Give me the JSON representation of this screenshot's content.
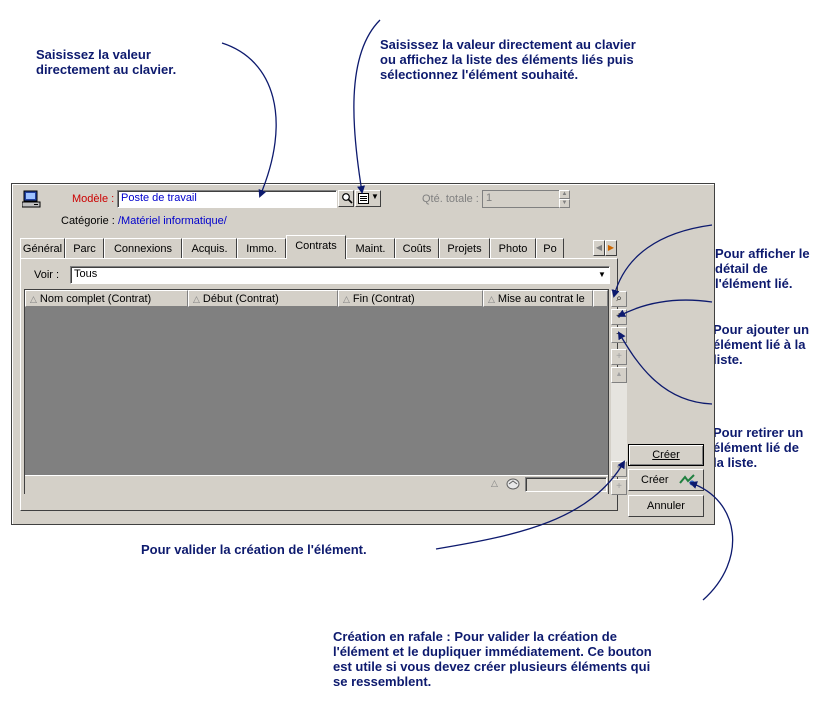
{
  "annotations": {
    "keyboard_input": [
      "Saisissez la valeur",
      "directement au clavier."
    ],
    "keyboard_or_list": [
      "Saisissez la valeur directement au clavier",
      "ou affichez la liste des éléments liés puis",
      "sélectionnez l'élément souhaité."
    ],
    "show_detail": [
      "Pour afficher le",
      "détail de",
      "l'élément lié."
    ],
    "add_linked": [
      "Pour ajouter un",
      "élément lié à la",
      "liste."
    ],
    "remove_linked": [
      "Pour retirer un",
      "élément lié de",
      "la liste."
    ],
    "validate": "Pour valider la création de l'élément.",
    "burst": [
      "Création en rafale : Pour valider la création de",
      "l'élément et le dupliquer immédiatement. Ce bouton",
      "est utile si vous devez créer plusieurs éléments qui",
      "se ressemblent."
    ]
  },
  "form": {
    "model_label": "Modèle :",
    "model_value": "Poste de travail",
    "category_label": "Catégorie :",
    "category_value": "/Matériel informatique/",
    "qty_label": "Qté. totale :",
    "qty_value": "1"
  },
  "tabs": [
    "Général",
    "Parc",
    "Connexions",
    "Acquis.",
    "Immo.",
    "Contrats",
    "Maint.",
    "Coûts",
    "Projets",
    "Photo",
    "Po"
  ],
  "active_tab": "Contrats",
  "view": {
    "label": "Voir :",
    "value": "Tous"
  },
  "table": {
    "columns": [
      "Nom complet (Contrat)",
      "Début (Contrat)",
      "Fin (Contrat)",
      "Mise au contrat le"
    ]
  },
  "buttons": {
    "create": "Créer",
    "create_burst": "Créer",
    "cancel": "Annuler"
  },
  "colors": {
    "annotation": "#0d1a6e",
    "window_bg": "#d4d0c8",
    "table_bg": "#808080",
    "link_blue": "#0000cc",
    "required_red": "#cc0000"
  }
}
